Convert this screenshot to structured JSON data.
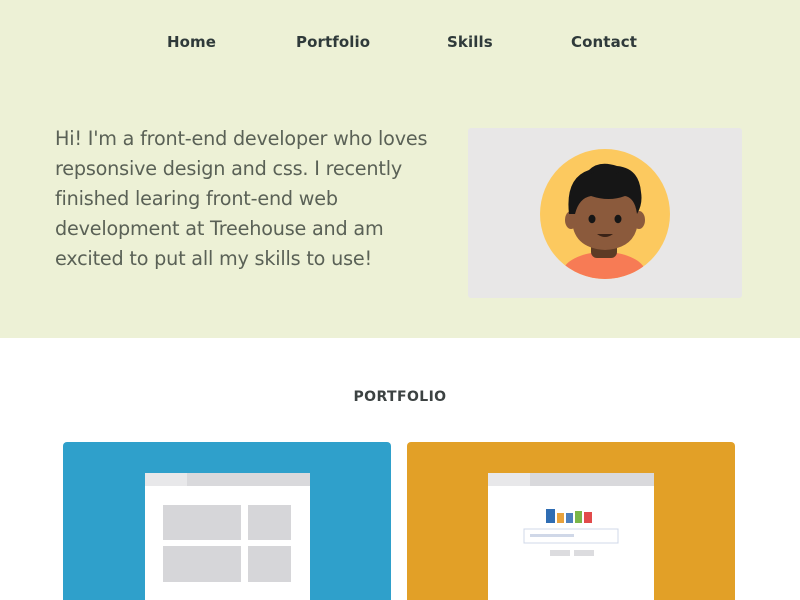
{
  "nav": {
    "items": [
      {
        "label": "Home"
      },
      {
        "label": "Portfolio"
      },
      {
        "label": "Skills"
      },
      {
        "label": "Contact"
      }
    ]
  },
  "hero": {
    "intro_text": "Hi! I'm a front-end developer who loves repsonsive design and css. I recently finished learing front-end web development at Treehouse and am excited to put all my skills to use!",
    "avatar_icon": "developer-avatar-icon",
    "background_color": "#edf1d6"
  },
  "portfolio": {
    "heading": "PORTFOLIO",
    "cards": [
      {
        "icon": "wireframe-layout-icon",
        "color": "#2fa0cb"
      },
      {
        "icon": "search-page-icon",
        "color": "#e2a027"
      }
    ]
  }
}
